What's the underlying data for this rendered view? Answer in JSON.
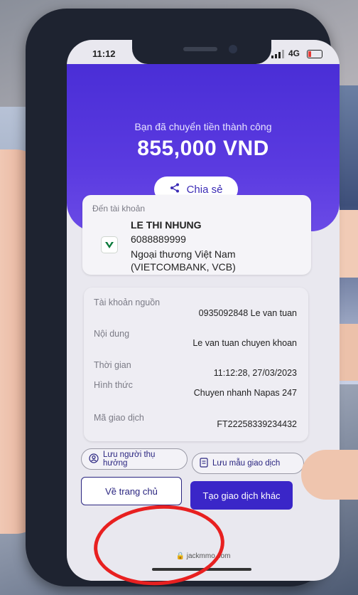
{
  "status_bar": {
    "time": "11:12",
    "network": "4G"
  },
  "header": {
    "subtitle": "Bạn đã chuyển tiền thành công",
    "amount": "855,000 VND",
    "share_label": "Chia sẻ"
  },
  "recipient": {
    "section_title": "Đến tài khoản",
    "name": "LE THI NHUNG",
    "account_number": "6088889999",
    "bank": "Ngoại thương Việt Nam (VIETCOMBANK, VCB)"
  },
  "details": [
    {
      "label": "Tài khoản nguồn",
      "value": "0935092848 Le van tuan"
    },
    {
      "label": "Nội dung",
      "value": "Le van tuan chuyen khoan"
    },
    {
      "label": "Thời gian",
      "value": "11:12:28, 27/03/2023"
    },
    {
      "label": "Hình thức",
      "value": "Chuyen nhanh Napas 247"
    },
    {
      "label": "Mã giao dịch",
      "value": "FT22258339234432"
    }
  ],
  "actions": {
    "save_beneficiary": "Lưu người thụ hưởng",
    "save_template": "Lưu mẫu giao dịch",
    "home": "Về trang chủ",
    "new_transaction": "Tạo giao dịch khác"
  },
  "browser": {
    "url": "jackmmo.com"
  },
  "colors": {
    "primary": "#4a2ed6",
    "button": "#3a26c8",
    "annotation": "#e82020"
  },
  "icons": [
    "share-icon",
    "vietcombank-logo-icon",
    "user-circle-icon",
    "document-icon",
    "lock-icon",
    "battery-icon"
  ]
}
